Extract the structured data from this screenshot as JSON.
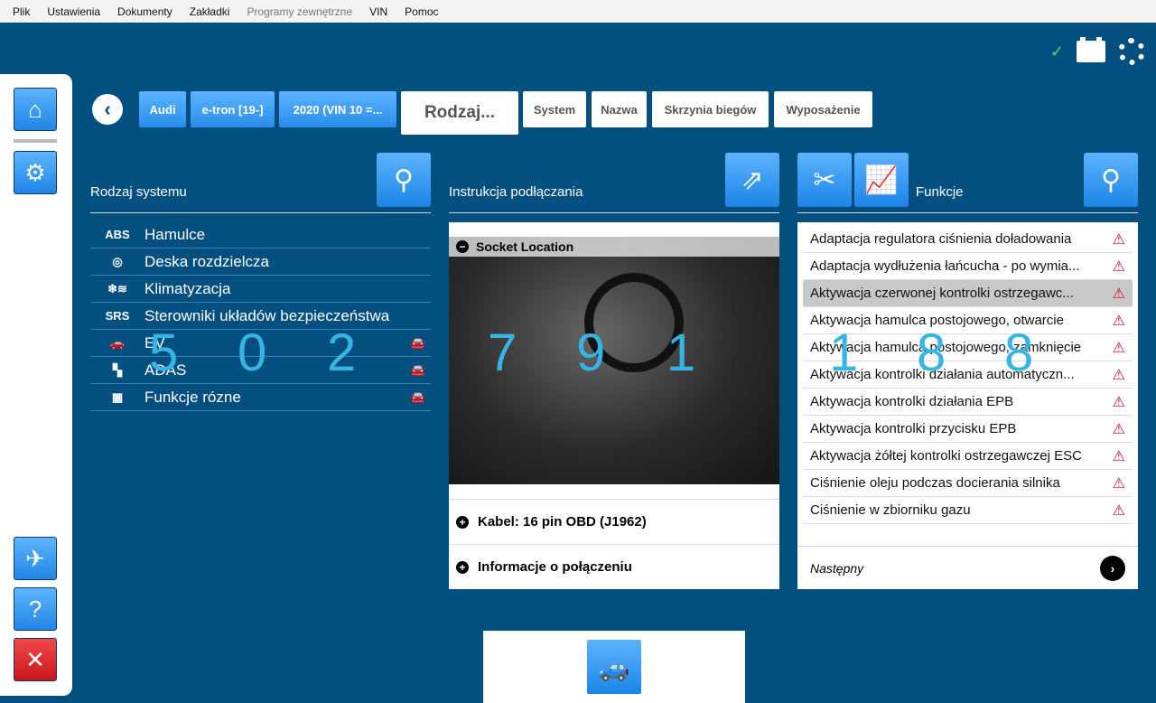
{
  "menu": [
    "Plik",
    "Ustawienia",
    "Dokumenty",
    "Zakładki",
    "Programy zewnętrzne",
    "VIN",
    "Pomoc"
  ],
  "status": {
    "check": "✓",
    "icons": [
      "check-icon",
      "battery-icon",
      "settings-gear-icon"
    ]
  },
  "breadcrumb": {
    "make": "Audi",
    "model": "e-tron [19-]",
    "year": "2020 (VIN 10 =...",
    "current": "Rodzaj...",
    "system": "System",
    "name": "Nazwa",
    "gearbox": "Skrzynia biegów",
    "equipment": "Wyposażenie"
  },
  "systems": {
    "title": "Rodzaj systemu",
    "items": [
      {
        "icon": "ABS",
        "label": "Hamulce"
      },
      {
        "icon": "◎",
        "label": "Deska rozdzielcza"
      },
      {
        "icon": "❄≋",
        "label": "Klimatyzacja"
      },
      {
        "icon": "SRS",
        "label": "Sterowniki układów bezpieczeństwa"
      },
      {
        "icon": "🚗",
        "label": "EV"
      },
      {
        "icon": "▚",
        "label": "ADAS"
      },
      {
        "icon": "▦",
        "label": "Funkcje rózne"
      }
    ]
  },
  "connection": {
    "title": "Instrukcja podłączania",
    "socket": "Socket Location",
    "cable": "Kabel: 16 pin OBD (J1962)",
    "info": "Informacje o połączeniu"
  },
  "functions": {
    "title": "Funkcje",
    "selected_index": 2,
    "items": [
      "Adaptacja regulatora ciśnienia doładowania",
      "Adaptacja wydłużenia łańcucha - po wymia...",
      "Aktywacja czerwonej kontrolki ostrzegawc...",
      "Aktywacja hamulca postojowego, otwarcie",
      "Aktywacja hamulca postojowego, zamknięcie",
      "Aktywacja kontrolki działania automatyczn...",
      "Aktywacja kontrolki działania EPB",
      "Aktywacja kontrolki przycisku EPB",
      "Aktywacja żółtej kontrolki ostrzegawczej ESC",
      "Ciśnienie oleju podczas docierania silnika",
      "Ciśnienie w zbiorniku gazu"
    ],
    "next": "Następny"
  },
  "watermark": [
    "5",
    "0",
    "2",
    "7",
    "9",
    "1",
    "1",
    "8",
    "8"
  ]
}
